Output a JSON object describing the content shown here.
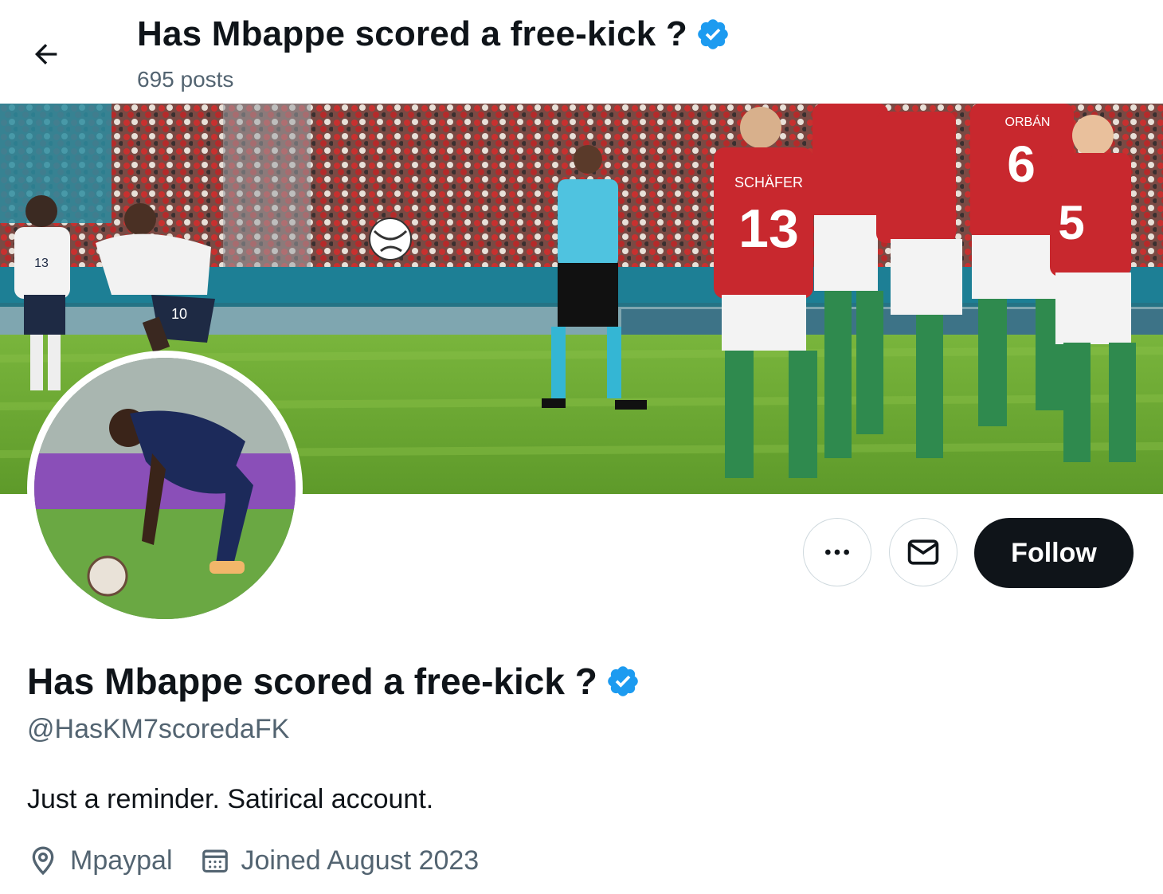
{
  "header": {
    "title": "Has Mbappe scored a free-kick ?",
    "posts_count": "695 posts"
  },
  "profile": {
    "display_name": "Has Mbappe scored a free-kick ?",
    "handle": "@HasKM7scoredaFK",
    "bio": "Just a reminder. Satirical account.",
    "location": "Mpaypal",
    "joined": "Joined August 2023",
    "verified": true
  },
  "actions": {
    "more_icon": "more-dots-icon",
    "message_icon": "envelope-icon",
    "follow_label": "Follow"
  },
  "banner": {
    "jersey_numbers": [
      "13",
      "6",
      "10",
      "5"
    ],
    "jersey_names": [
      "SCHÄFER",
      "ORBÁN"
    ]
  },
  "colors": {
    "verified_blue": "#1d9bf0",
    "follow_bg": "#0f1419",
    "secondary_text": "#536471"
  }
}
